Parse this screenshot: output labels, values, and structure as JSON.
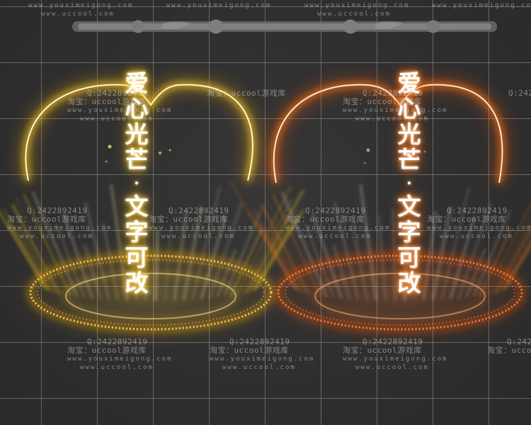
{
  "palette": {
    "background": "#2e2e2e",
    "grid": "#969696",
    "gold_arc": "#ffd21a",
    "gold_glow": "#ffb000",
    "orange_arc": "#ff7a1a",
    "orange_glow": "#ff5200",
    "ring_gold": "#ffc93a",
    "ring_orange": "#ff7a2a",
    "banner": "#8a8a8a"
  },
  "panels": [
    {
      "name": "gold",
      "title_chars": [
        "爱",
        "心",
        "光",
        "芒",
        "·",
        "文",
        "字",
        "可",
        "改"
      ]
    },
    {
      "name": "orange",
      "title_chars": [
        "爱",
        "心",
        "光",
        "芒",
        "·",
        "文",
        "字",
        "可",
        "改"
      ]
    }
  ],
  "watermark": {
    "site_youxi": "www.youximeigong.com",
    "site_uccool": "www.uccool.com",
    "qq": "Q:2422892419",
    "taobao": "淘宝：uccool游戏库"
  }
}
